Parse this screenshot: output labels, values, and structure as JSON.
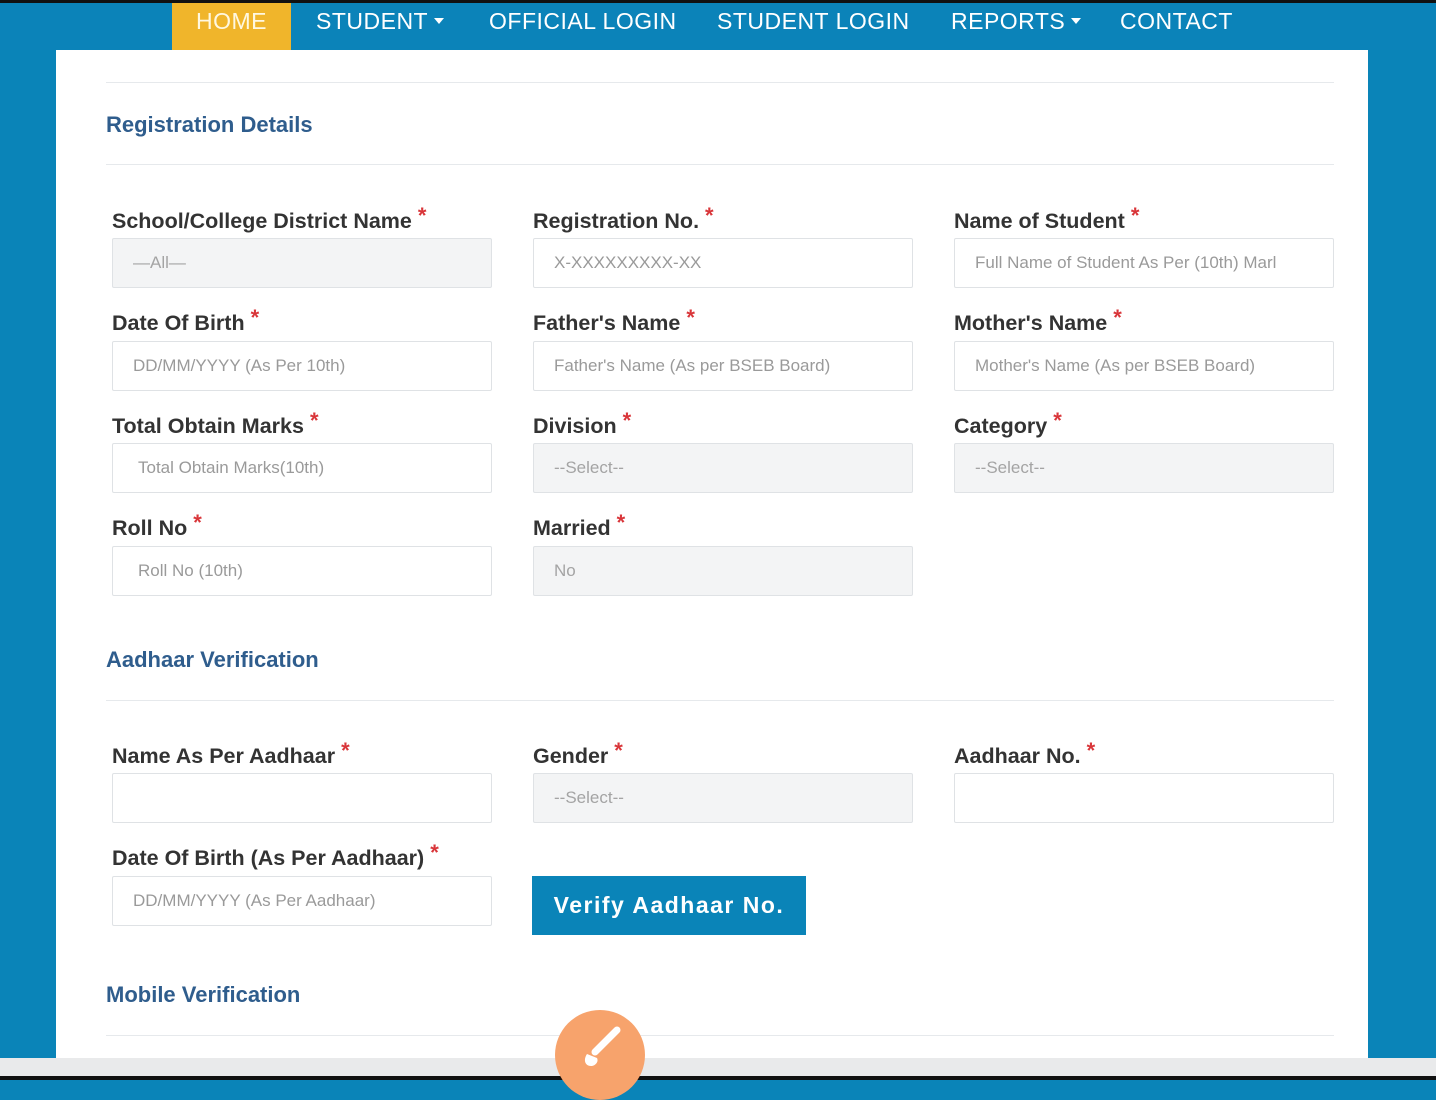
{
  "nav": {
    "home": "HOME",
    "student": "STUDENT",
    "official_login": "OFFICIAL LOGIN",
    "student_login": "STUDENT LOGIN",
    "reports": "REPORTS",
    "contact": "CONTACT",
    "active_color": "#f0b52b",
    "bar_color": "#0b83b9"
  },
  "required_marker": "*",
  "registration": {
    "title": "Registration Details",
    "district": {
      "label": "School/College District Name",
      "value": "—All—"
    },
    "reg_no": {
      "label": "Registration No.",
      "placeholder": "X-XXXXXXXXX-XX"
    },
    "student_name": {
      "label": "Name of Student",
      "placeholder": "Full Name of Student As Per (10th) Marl"
    },
    "dob": {
      "label": "Date Of Birth",
      "placeholder": "DD/MM/YYYY (As Per 10th)"
    },
    "father": {
      "label": "Father's Name",
      "placeholder": "Father's Name (As per BSEB Board)"
    },
    "mother": {
      "label": "Mother's Name",
      "placeholder": "Mother's Name (As per BSEB Board)"
    },
    "marks": {
      "label": "Total Obtain Marks",
      "placeholder": "Total Obtain Marks(10th)"
    },
    "division": {
      "label": "Division",
      "value": "--Select--"
    },
    "category": {
      "label": "Category",
      "value": "--Select--"
    },
    "roll": {
      "label": "Roll No",
      "placeholder": "Roll No (10th)"
    },
    "married": {
      "label": "Married",
      "value": "No"
    }
  },
  "aadhaar": {
    "title": "Aadhaar Verification",
    "name": {
      "label": "Name As Per Aadhaar",
      "value": ""
    },
    "gender": {
      "label": "Gender",
      "value": "--Select--"
    },
    "number": {
      "label": "Aadhaar No.",
      "value": ""
    },
    "dob": {
      "label": "Date Of Birth (As Per Aadhaar)",
      "placeholder": "DD/MM/YYYY (As Per Aadhaar)"
    },
    "verify_button": "Verify Aadhaar No."
  },
  "mobile": {
    "title": "Mobile Verification"
  },
  "colors": {
    "accent": "#0a84b8",
    "required": "#d9363a",
    "section_title": "#2f5d8d",
    "fab": "#f7a36c"
  },
  "icons": {
    "fab": "paintbrush-icon",
    "dropdown": "caret-down-icon"
  }
}
